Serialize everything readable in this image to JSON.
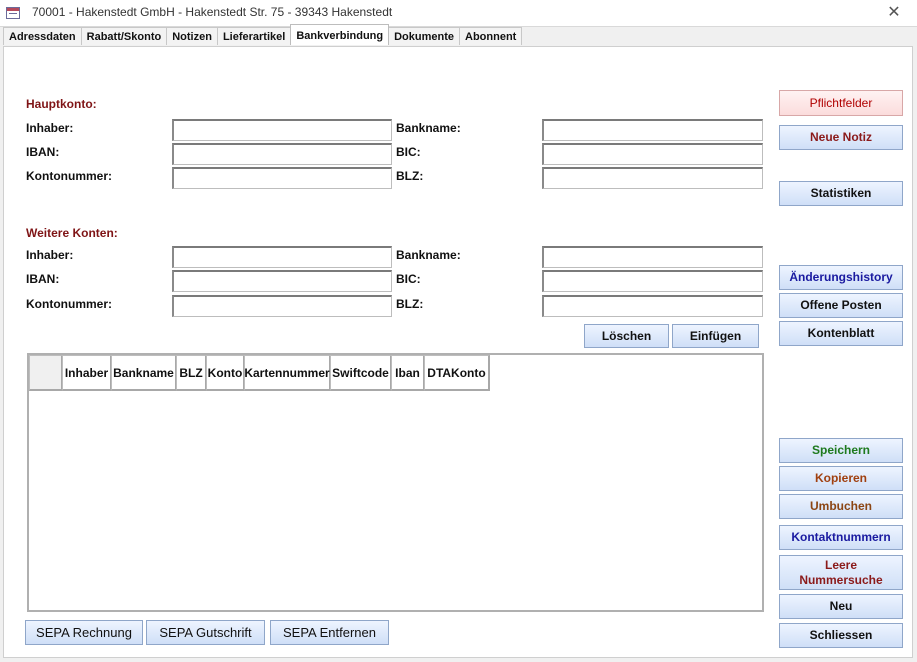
{
  "window": {
    "title": "70001  -  Hakenstedt GmbH  - Hakenstedt Str. 75 - 39343 Hakenstedt",
    "close_symbol": "✕",
    "icon": "form-icon"
  },
  "tabs": [
    {
      "label": "Adressdaten",
      "active": false
    },
    {
      "label": "Rabatt/Skonto",
      "active": false
    },
    {
      "label": "Notizen",
      "active": false
    },
    {
      "label": "Lieferartikel",
      "active": false
    },
    {
      "label": "Bankverbindung",
      "active": true
    },
    {
      "label": "Dokumente",
      "active": false
    },
    {
      "label": "Abonnent",
      "active": false
    }
  ],
  "hauptkonto": {
    "title": "Hauptkonto:",
    "inhaber_label": "Inhaber:",
    "inhaber_value": "",
    "iban_label": "IBAN:",
    "iban_value": "",
    "kontonummer_label": "Kontonummer:",
    "kontonummer_value": "",
    "bankname_label": "Bankname:",
    "bankname_value": "",
    "bic_label": "BIC:",
    "bic_value": "",
    "blz_label": "BLZ:",
    "blz_value": ""
  },
  "weitere": {
    "title": "Weitere Konten:",
    "inhaber_label": "Inhaber:",
    "inhaber_value": "",
    "iban_label": "IBAN:",
    "iban_value": "",
    "kontonummer_label": "Kontonummer:",
    "kontonummer_value": "",
    "bankname_label": "Bankname:",
    "bankname_value": "",
    "bic_label": "BIC:",
    "bic_value": "",
    "blz_label": "BLZ:",
    "blz_value": ""
  },
  "actions": {
    "loeschen": "Löschen",
    "einfuegen": "Einfügen"
  },
  "table": {
    "columns": [
      "Inhaber",
      "Bankname",
      "BLZ",
      "Konto",
      "Kartennummer",
      "Swiftcode",
      "Iban",
      "DTAKonto"
    ],
    "rows": []
  },
  "sepa": {
    "rechnung": "SEPA Rechnung",
    "gutschrift": "SEPA Gutschrift",
    "entfernen": "SEPA Entfernen"
  },
  "sidebar": [
    {
      "id": "pflichtfelder",
      "label": "Pflichtfelder",
      "color": "#b00000",
      "style": "pink"
    },
    {
      "id": "neue-notiz",
      "label": "Neue Notiz",
      "color": "#8b1a1a"
    },
    {
      "id": "statistiken",
      "label": "Statistiken",
      "color": "#111111"
    },
    {
      "id": "aenderungshistory",
      "label": "Änderungshistory",
      "color": "#1a1aa0"
    },
    {
      "id": "offene-posten",
      "label": "Offene Posten",
      "color": "#111111"
    },
    {
      "id": "kontenblatt",
      "label": "Kontenblatt",
      "color": "#111111"
    },
    {
      "id": "speichern",
      "label": "Speichern",
      "color": "#1e7a1e"
    },
    {
      "id": "kopieren",
      "label": "Kopieren",
      "color": "#a04010"
    },
    {
      "id": "umbuchen",
      "label": "Umbuchen",
      "color": "#8b4513"
    },
    {
      "id": "kontaktnummern",
      "label": "Kontaktnummern",
      "color": "#1a1aa0"
    },
    {
      "id": "leere-nummersuche",
      "label": "Leere Nummersuche",
      "color": "#8b1a1a"
    },
    {
      "id": "neu",
      "label": "Neu",
      "color": "#111111"
    },
    {
      "id": "schliessen",
      "label": "Schliessen",
      "color": "#111111"
    }
  ]
}
